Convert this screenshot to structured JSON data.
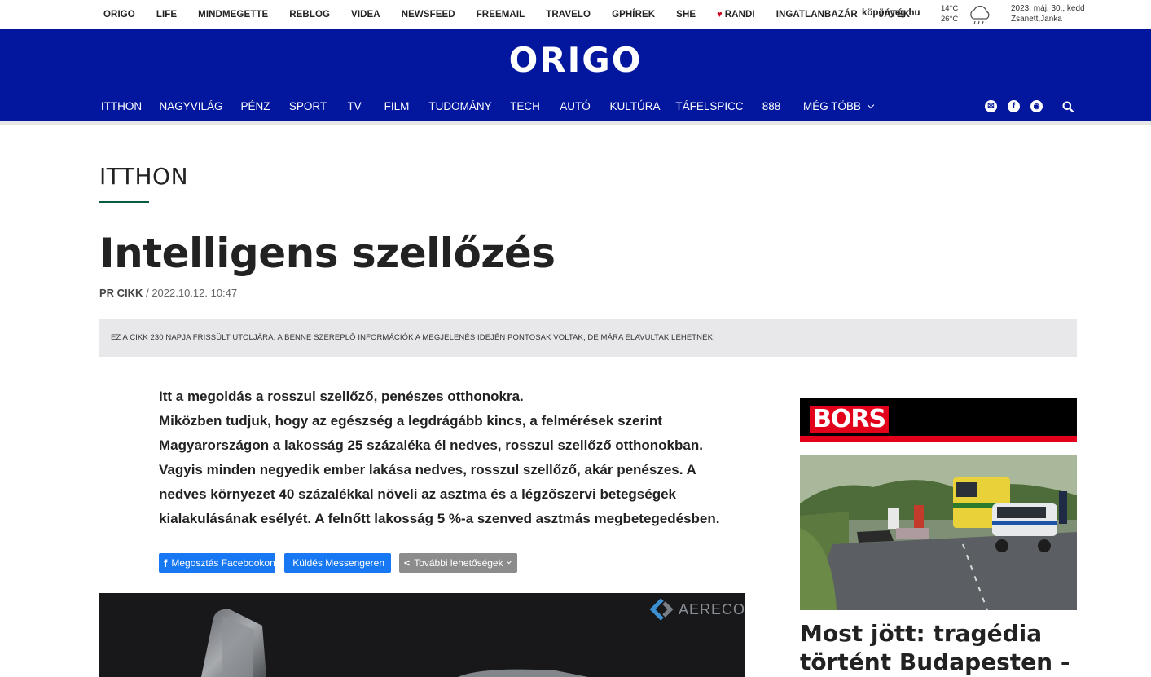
{
  "topbar": {
    "links": [
      "ORIGO",
      "LIFE",
      "MINDMEGETTE",
      "REBLOG",
      "VIDEA",
      "NEWSFEED",
      "FREEMAIL",
      "TRAVELO",
      "GPHÍREK",
      "SHE",
      "RANDI",
      "INGATLANBAZÁR",
      "JÁTÉK"
    ],
    "weather_site": "köpönyeg.hu",
    "temp_low": "14°C",
    "temp_high": "26°C",
    "date": "2023. máj. 30., kedd",
    "namedays": "Zsanett,Janka"
  },
  "header": {
    "logo": "ORIGO",
    "nav": [
      {
        "label": "ITTHON",
        "color": "#0b5c3e"
      },
      {
        "label": "NAGYVILÁG",
        "color": "#4caf1e"
      },
      {
        "label": "PÉNZ",
        "color": "#2bb673"
      },
      {
        "label": "SPORT",
        "color": "#1aa6e0"
      },
      {
        "label": "TV",
        "color": "#1a2ab8"
      },
      {
        "label": "FILM",
        "color": "#7c3fb5"
      },
      {
        "label": "TUDOMÁNY",
        "color": "#b53fb5"
      },
      {
        "label": "TECH",
        "color": "#e8b400"
      },
      {
        "label": "AUTÓ",
        "color": "#e85a3a"
      },
      {
        "label": "KULTÚRA",
        "color": "#7a1248"
      },
      {
        "label": "TÁFELSPICC",
        "color": "#b0126a"
      },
      {
        "label": "888",
        "color": "#d6126e"
      },
      {
        "label": "MÉG TÖBB",
        "color": "#e6e6e6"
      }
    ]
  },
  "article": {
    "section": "ITTHON",
    "title": "Intelligens szellőzés",
    "author": "PR CIKK",
    "date": "2022.10.12. 10:47",
    "notice": "EZ A CIKK 230 NAPJA FRISSÜLT UTOLJÁRA. A BENNE SZEREPLŐ INFORMÁCIÓK A MEGJELENÉS IDEJÉN PONTOSAK VOLTAK, DE MÁRA ELAVULTAK LEHETNEK.",
    "lead_lines": [
      "Itt a megoldás a rosszul szellőző, penészes otthonokra.",
      "Miközben tudjuk, hogy az egészség a legdrágább kincs, a felmérések szerint",
      "Magyarországon a lakosság 25 százaléka él nedves, rosszul szellőző otthonokban.",
      "Vagyis minden negyedik ember lakása nedves, rosszul szellőző, akár penészes. A",
      "nedves környezet 40 százalékkal növeli az asztma és a légzőszervi betegségek",
      "kialakulásának esélyét. A felnőtt lakosság 5 %-a szenved asztmás megbetegedésben."
    ],
    "share_facebook": "Megosztás Facebookon",
    "share_messenger": "Küldés Messengeren",
    "share_more": "További lehetőségek",
    "image_brand": "AERECO"
  },
  "sidebar": {
    "brand": "BORS",
    "news_title": "Most jött: tragédia történt Budapesten -"
  }
}
